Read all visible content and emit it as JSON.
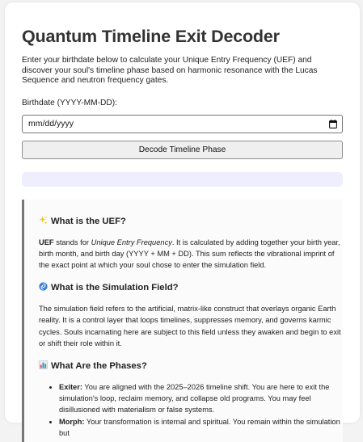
{
  "title": "Quantum Timeline Exit Decoder",
  "intro": "Enter your birthdate below to calculate your Unique Entry Frequency (UEF) and discover your soul's timeline phase based on harmonic resonance with the Lucas Sequence and neutron frequency gates.",
  "birthdate": {
    "label": "Birthdate (YYYY-MM-DD):",
    "placeholder": "mm/dd/yyyy"
  },
  "decode_button_label": "Decode Timeline Phase",
  "result_text": "",
  "colors": {
    "result_box": "#eeeeff",
    "info_border": "#777777"
  },
  "sections": {
    "uef": {
      "icon": "sparkles-icon",
      "heading": "What is the UEF?",
      "p_lead": "UEF",
      "p_mid": " stands for ",
      "p_em": "Unique Entry Frequency",
      "p_rest": ". It is calculated by adding together your birth year, birth month, and birth day (YYYY + MM + DD). This sum reflects the vibrational imprint of the exact point at which your soul chose to enter the simulation field."
    },
    "field": {
      "icon": "cyclone-icon",
      "heading": "What is the Simulation Field?",
      "p": "The simulation field refers to the artificial, matrix-like construct that overlays organic Earth reality. It is a control layer that loops timelines, suppresses memory, and governs karmic cycles. Souls incarnating here are subject to this field unless they awaken and begin to exit or shift their role within it."
    },
    "phases": {
      "icon": "bar-chart-icon",
      "heading": "What Are the Phases?",
      "items": [
        {
          "name": "Exiter:",
          "text": " You are aligned with the 2025–2026 timeline shift. You are here to exit the simulation's loop, reclaim memory, and collapse old programs. You may feel disillusioned with materialism or false systems."
        },
        {
          "name": "Morph:",
          "text": " Your transformation is internal and spiritual. You remain within the simulation but"
        }
      ]
    }
  }
}
